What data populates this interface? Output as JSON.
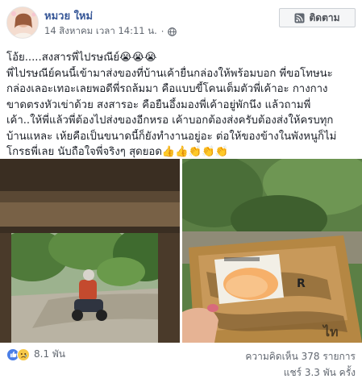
{
  "post": {
    "author": "หมวย ใหม่",
    "timestamp": "14 สิงหาคม เวลา 14:11 น.",
    "separator": "·",
    "privacy_icon": "globe-icon",
    "follow_label": "ติดตาม",
    "follow_icon": "rss-icon",
    "lines": [
      "โอ้ย.....สงสารพี่ไปรษณีย์😭😭😭",
      "พี่ไปรษณีย์คนนี้เข้ามาส่งของที่บ้านเค้ายื่นกล่องให้พร้อมบอก พี่ขอโทษนะ",
      "กล่องเลอะเทอะเลยพอดีพี่รถล้มมา คือแบบขี้โคนเต็มตัวพี่เค้าอะ กางกาง",
      "ขาดตรงหัวเข่าด้วย สงสารอะ คือยืนอึ้งมองพี่เค้าอยู่พักนึง แล้วถามพี่",
      "เค้า..ให้พี่แล้วพี่ต้องไปส่งของอีกหรอ เค้าบอกต้องส่งครับต้องส่งให้ครบทุก",
      "บ้านแหละ เห้ยคือเป็นขนาดนี้ก็ยังทำงานอยู่อะ ต่อให้ของข้างในพังหนูก็ไม่",
      "โกรธพี่เลย นับถือใจพี่จริงๆ สุดยอด👍👍👏👏👏"
    ]
  },
  "photos": {
    "left_alt": "postman-on-motorbike-photo",
    "right_alt": "muddy-parcel-photo",
    "label_mark": "R"
  },
  "footer": {
    "reaction_icons": [
      "like-icon",
      "sad-icon"
    ],
    "reaction_count": "8.1 พัน",
    "comments": "ความคิดเห็น 378 รายการ",
    "shares": "แชร์ 3.3 พัน ครั้ง"
  },
  "colors": {
    "author": "#385898",
    "meta": "#616770",
    "like": "#4a7ee6",
    "sad": "#f7c948"
  }
}
